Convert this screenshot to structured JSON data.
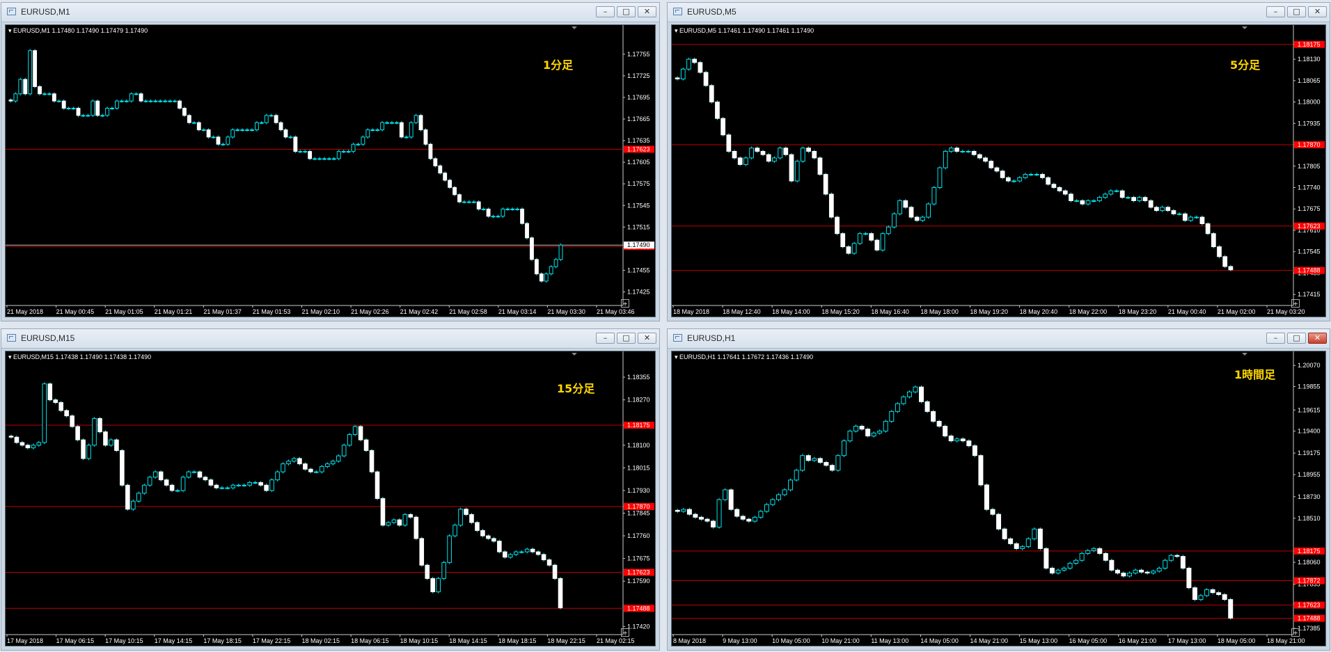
{
  "colors": {
    "background": "#000000",
    "candle": "#00e5ee",
    "level_line": "#c00000",
    "price_tag": "#ff0000",
    "label": "#ffd700",
    "axis_text": "#ffffff"
  },
  "windows": [
    {
      "id": "m1",
      "title": "EURUSD,M1",
      "header": "EURUSD,M1  1.17480 1.17490 1.17479 1.17490",
      "timeframe_label": "1分足",
      "controls": [
        "minimize",
        "maximize",
        "close"
      ],
      "active": false,
      "y_ticks": [
        "1.17755",
        "1.17725",
        "1.17695",
        "1.17665",
        "1.17635",
        "1.17605",
        "1.17575",
        "1.17545",
        "1.17515",
        "1.17455",
        "1.17425"
      ],
      "x_ticks": [
        "21 May 2018",
        "21 May 00:45",
        "21 May 01:05",
        "21 May 01:21",
        "21 May 01:37",
        "21 May 01:53",
        "21 May 02:10",
        "21 May 02:26",
        "21 May 02:42",
        "21 May 02:58",
        "21 May 03:14",
        "21 May 03:30",
        "21 May 03:46"
      ],
      "y_range": [
        1.1741,
        1.1778
      ],
      "levels": [
        1.17623,
        1.17488
      ],
      "level_labels": [
        "1.17623",
        "1.17488"
      ],
      "bid_line": 1.1749,
      "bid_label": "1.17490",
      "chart_data": {
        "type": "candlestick",
        "closes": [
          1.1769,
          1.177,
          1.1772,
          1.177,
          1.1776,
          1.1771,
          1.177,
          1.177,
          1.177,
          1.1769,
          1.1769,
          1.1768,
          1.1768,
          1.1768,
          1.1767,
          1.1767,
          1.1767,
          1.1769,
          1.1767,
          1.1767,
          1.1768,
          1.1768,
          1.1769,
          1.1769,
          1.1769,
          1.177,
          1.177,
          1.1769,
          1.1769,
          1.1769,
          1.1769,
          1.1769,
          1.1769,
          1.1769,
          1.1769,
          1.1768,
          1.1767,
          1.1766,
          1.1766,
          1.1765,
          1.1765,
          1.1764,
          1.1764,
          1.1763,
          1.1763,
          1.1764,
          1.1765,
          1.1765,
          1.1765,
          1.1765,
          1.1765,
          1.1766,
          1.1766,
          1.1767,
          1.1767,
          1.1766,
          1.1765,
          1.1764,
          1.1764,
          1.1762,
          1.1762,
          1.1762,
          1.1761,
          1.1761,
          1.1761,
          1.1761,
          1.1761,
          1.1761,
          1.1762,
          1.1762,
          1.1762,
          1.1763,
          1.1763,
          1.1764,
          1.1765,
          1.1765,
          1.1765,
          1.1766,
          1.1766,
          1.1766,
          1.1766,
          1.1764,
          1.1764,
          1.1766,
          1.1767,
          1.1765,
          1.1763,
          1.1761,
          1.176,
          1.1759,
          1.1758,
          1.1757,
          1.1756,
          1.1755,
          1.1755,
          1.1755,
          1.1755,
          1.1754,
          1.1754,
          1.1753,
          1.1753,
          1.1753,
          1.1754,
          1.1754,
          1.1754,
          1.1754,
          1.1752,
          1.175,
          1.1747,
          1.1745,
          1.1744,
          1.1745,
          1.1746,
          1.1747,
          1.1749
        ]
      }
    },
    {
      "id": "m5",
      "title": "EURUSD,M5",
      "header": "EURUSD,M5  1.17461 1.17490 1.17461 1.17490",
      "timeframe_label": "5分足",
      "controls": [
        "minimize",
        "maximize",
        "close"
      ],
      "active": false,
      "y_ticks": [
        "1.18175",
        "1.18130",
        "1.18065",
        "1.18000",
        "1.17935",
        "1.17870",
        "1.17805",
        "1.17740",
        "1.17675",
        "1.17610",
        "1.17545",
        "1.17480",
        "1.17415"
      ],
      "x_ticks": [
        "18 May 2018",
        "18 May 12:40",
        "18 May 14:00",
        "18 May 15:20",
        "18 May 16:40",
        "18 May 18:00",
        "18 May 19:20",
        "18 May 20:40",
        "18 May 22:00",
        "18 May 23:20",
        "21 May 00:40",
        "21 May 02:00",
        "21 May 03:20"
      ],
      "y_range": [
        1.1739,
        1.182
      ],
      "levels": [
        1.18175,
        1.1787,
        1.17623,
        1.17488
      ],
      "level_labels": [
        "1.18175",
        "1.17870",
        "1.17623",
        "1.17488"
      ],
      "bid_line": null,
      "bid_label": "",
      "chart_data": {
        "type": "candlestick",
        "closes": [
          1.1807,
          1.181,
          1.1813,
          1.1812,
          1.1809,
          1.1805,
          1.18,
          1.1795,
          1.179,
          1.1785,
          1.1783,
          1.1781,
          1.1783,
          1.1786,
          1.1785,
          1.1784,
          1.1782,
          1.1783,
          1.1786,
          1.1784,
          1.1776,
          1.1782,
          1.1786,
          1.1785,
          1.1783,
          1.1778,
          1.1772,
          1.1765,
          1.176,
          1.1756,
          1.1754,
          1.1757,
          1.176,
          1.176,
          1.1758,
          1.1755,
          1.176,
          1.1762,
          1.1766,
          1.177,
          1.1768,
          1.1765,
          1.1764,
          1.1765,
          1.1769,
          1.1774,
          1.178,
          1.1785,
          1.1786,
          1.1785,
          1.1785,
          1.1785,
          1.1784,
          1.1783,
          1.1782,
          1.178,
          1.1779,
          1.1777,
          1.1776,
          1.1776,
          1.1777,
          1.1778,
          1.1778,
          1.1778,
          1.1777,
          1.1775,
          1.1774,
          1.1773,
          1.1772,
          1.177,
          1.177,
          1.1769,
          1.177,
          1.177,
          1.1771,
          1.1772,
          1.1773,
          1.1773,
          1.1771,
          1.1771,
          1.177,
          1.1771,
          1.177,
          1.1768,
          1.1767,
          1.1768,
          1.1767,
          1.1766,
          1.1766,
          1.1764,
          1.1765,
          1.1765,
          1.1763,
          1.176,
          1.1756,
          1.1753,
          1.175,
          1.1749
        ]
      }
    },
    {
      "id": "m15",
      "title": "EURUSD,M15",
      "header": "EURUSD,M15  1.17438 1.17490 1.17438 1.17490",
      "timeframe_label": "15分足",
      "controls": [
        "minimize",
        "maximize",
        "close"
      ],
      "active": false,
      "y_ticks": [
        "1.18355",
        "1.18270",
        "1.18175",
        "1.18100",
        "1.18015",
        "1.17930",
        "1.17870",
        "1.17845",
        "1.17760",
        "1.17675",
        "1.17590",
        "1.17420"
      ],
      "x_ticks": [
        "17 May 2018",
        "17 May 06:15",
        "17 May 10:15",
        "17 May 14:15",
        "17 May 18:15",
        "17 May 22:15",
        "18 May 02:15",
        "18 May 06:15",
        "18 May 10:15",
        "18 May 14:15",
        "18 May 18:15",
        "18 May 22:15",
        "21 May 02:15"
      ],
      "y_range": [
        1.174,
        1.1841
      ],
      "levels": [
        1.18175,
        1.1787,
        1.17623,
        1.17488
      ],
      "level_labels": [
        "1.18175",
        "1.17870",
        "1.17623",
        "1.17488"
      ],
      "bid_line": null,
      "bid_label": "",
      "chart_data": {
        "type": "candlestick",
        "closes": [
          1.1813,
          1.1811,
          1.181,
          1.1809,
          1.181,
          1.1811,
          1.1833,
          1.1827,
          1.1826,
          1.1823,
          1.1821,
          1.1817,
          1.1812,
          1.1805,
          1.181,
          1.182,
          1.1815,
          1.181,
          1.1812,
          1.1808,
          1.1795,
          1.1786,
          1.1789,
          1.1792,
          1.1795,
          1.1798,
          1.18,
          1.1797,
          1.1795,
          1.1793,
          1.1793,
          1.1798,
          1.18,
          1.18,
          1.1798,
          1.1797,
          1.1795,
          1.1794,
          1.1794,
          1.1794,
          1.1795,
          1.1795,
          1.1795,
          1.1796,
          1.1796,
          1.1795,
          1.1793,
          1.1797,
          1.18,
          1.1803,
          1.1804,
          1.1805,
          1.1803,
          1.1801,
          1.18,
          1.18,
          1.1802,
          1.1803,
          1.1804,
          1.1806,
          1.181,
          1.1814,
          1.1817,
          1.1812,
          1.1808,
          1.18,
          1.179,
          1.178,
          1.1781,
          1.1782,
          1.178,
          1.1784,
          1.1783,
          1.1775,
          1.1765,
          1.176,
          1.1755,
          1.176,
          1.1766,
          1.1776,
          1.178,
          1.1786,
          1.1784,
          1.1781,
          1.1778,
          1.1776,
          1.1775,
          1.1774,
          1.177,
          1.1768,
          1.1769,
          1.177,
          1.177,
          1.1771,
          1.177,
          1.1769,
          1.1767,
          1.1765,
          1.176,
          1.1749
        ]
      }
    },
    {
      "id": "h1",
      "title": "EURUSD,H1",
      "header": "EURUSD,H1  1.17641 1.17672 1.17436 1.17490",
      "timeframe_label": "1時間足",
      "controls": [
        "minimize",
        "maximize",
        "close"
      ],
      "active": true,
      "y_ticks": [
        "1.20070",
        "1.19855",
        "1.19615",
        "1.19400",
        "1.19175",
        "1.18955",
        "1.18730",
        "1.18510",
        "1.18175",
        "1.18060",
        "1.17835",
        "1.17635",
        "1.17385"
      ],
      "x_ticks": [
        "8 May 2018",
        "9 May 13:00",
        "10 May 05:00",
        "10 May 21:00",
        "11 May 13:00",
        "14 May 05:00",
        "14 May 21:00",
        "15 May 13:00",
        "16 May 05:00",
        "16 May 21:00",
        "17 May 13:00",
        "18 May 05:00",
        "18 May 21:00"
      ],
      "y_range": [
        1.1735,
        1.201
      ],
      "levels": [
        1.18175,
        1.17872,
        1.17623,
        1.17488
      ],
      "level_labels": [
        "1.18175",
        "1.17872",
        "1.17623",
        "1.17488"
      ],
      "bid_line": null,
      "bid_label": "",
      "chart_data": {
        "type": "candlestick",
        "closes": [
          1.1858,
          1.186,
          1.1855,
          1.1852,
          1.185,
          1.1848,
          1.1842,
          1.187,
          1.188,
          1.186,
          1.1853,
          1.185,
          1.1848,
          1.1852,
          1.1858,
          1.1865,
          1.187,
          1.1875,
          1.188,
          1.189,
          1.19,
          1.1915,
          1.191,
          1.1912,
          1.1908,
          1.1905,
          1.19,
          1.1915,
          1.193,
          1.194,
          1.1945,
          1.1942,
          1.1935,
          1.1938,
          1.194,
          1.195,
          1.196,
          1.1968,
          1.1975,
          1.198,
          1.1985,
          1.197,
          1.196,
          1.195,
          1.1945,
          1.1935,
          1.193,
          1.1932,
          1.193,
          1.1925,
          1.1915,
          1.1885,
          1.186,
          1.1855,
          1.184,
          1.183,
          1.1825,
          1.182,
          1.1822,
          1.183,
          1.184,
          1.182,
          1.18,
          1.1795,
          1.1798,
          1.18,
          1.1805,
          1.1808,
          1.1815,
          1.1818,
          1.182,
          1.1815,
          1.1808,
          1.1798,
          1.1795,
          1.1792,
          1.1795,
          1.1798,
          1.1796,
          1.1795,
          1.1797,
          1.18,
          1.1808,
          1.1813,
          1.1812,
          1.18,
          1.178,
          1.1768,
          1.1772,
          1.1778,
          1.1775,
          1.1773,
          1.1768,
          1.1749
        ]
      }
    }
  ]
}
